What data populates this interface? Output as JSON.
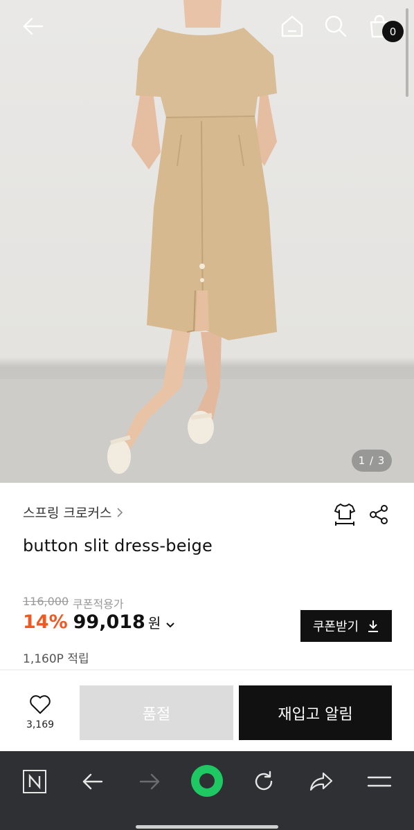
{
  "header": {
    "icons": [
      "back-arrow-icon",
      "home-icon",
      "search-icon",
      "shopping-bag-icon"
    ],
    "cart_count": "0"
  },
  "gallery": {
    "indicator": "1 / 3"
  },
  "product": {
    "brand": "스프링 크로커스",
    "name": "button slit dress-beige",
    "original_price": "116,000",
    "coupon_note": "쿠폰적용가",
    "discount": "14%",
    "price": "99,018",
    "currency": "원",
    "points": "1,160P 적립",
    "coupon_button": "쿠폰받기",
    "icons": [
      "size-guide-icon",
      "share-icon"
    ]
  },
  "actions": {
    "like_count": "3,169",
    "soldout_label": "품절",
    "restock_label": "재입고 알림"
  },
  "browser_toolbar": {
    "items": [
      "naver-n-icon",
      "back-icon",
      "forward-icon",
      "green-dot-icon",
      "reload-icon",
      "share-icon",
      "menu-icon"
    ]
  },
  "colors": {
    "accent_discount": "#ef5a23",
    "button_dark": "#111111",
    "button_disabled": "#dcdcdc",
    "toolbar_bg": "#2f3034",
    "green_dot": "#1ec963"
  }
}
